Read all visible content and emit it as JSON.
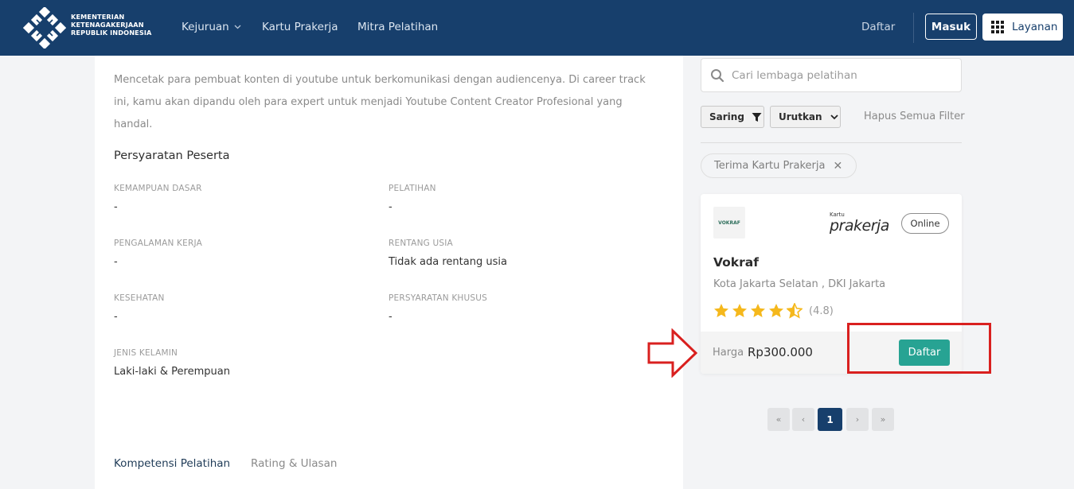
{
  "header": {
    "logo_lines": [
      "KEMENTERIAN",
      "KETENAGAKERJAAN",
      "REPUBLIK INDONESIA"
    ],
    "nav": [
      {
        "label": "Kejuruan",
        "has_dropdown": true,
        "icon": "chevron-down-icon"
      },
      {
        "label": "Kartu Prakerja"
      },
      {
        "label": "Mitra Pelatihan"
      }
    ],
    "daftar_label": "Daftar",
    "masuk_label": "Masuk",
    "layanan_label": "Layanan",
    "colors": {
      "bar": "#173f6c"
    }
  },
  "content": {
    "description": "Mencetak para pembuat konten di youtube untuk berkomunikasi dengan audiencenya. Di career track ini, kamu akan dipandu oleh para expert untuk menjadi Youtube Content Creator Profesional yang handal.",
    "requirements_title": "Persyaratan Peserta",
    "requirements": [
      {
        "label": "KEMAMPUAN DASAR",
        "value": "-"
      },
      {
        "label": "PELATIHAN",
        "value": "-"
      },
      {
        "label": "PENGALAMAN KERJA",
        "value": "-"
      },
      {
        "label": "RENTANG USIA",
        "value": "Tidak ada rentang usia"
      },
      {
        "label": "KESEHATAN",
        "value": "-"
      },
      {
        "label": "PERSYARATAN KHUSUS",
        "value": "-"
      },
      {
        "label": "JENIS KELAMIN",
        "value": "Laki-laki & Perempuan"
      }
    ],
    "tabs": [
      {
        "label": "Kompetensi Pelatihan",
        "active": true
      },
      {
        "label": "Rating & Ulasan",
        "active": false
      }
    ]
  },
  "sidebar": {
    "search_placeholder": "Cari lembaga pelatihan",
    "filter_label": "Saring",
    "sort_label": "Urutkan",
    "clear_filters_label": "Hapus Semua Filter",
    "active_filter": "Terima Kartu Prakerja",
    "card": {
      "provider_logo_text": "VOKRAF",
      "partner_logo_small": "Kartu",
      "partner_logo_big": "prakerja",
      "mode": "Online",
      "name": "Vokraf",
      "location": "Kota Jakarta Selatan , DKI Jakarta",
      "rating": 4.8,
      "rating_text": "(4.8)",
      "price_label": "Harga",
      "price": "Rp300.000",
      "daftar_label": "Daftar",
      "colors": {
        "button": "#27a393",
        "star": "#f5b81c"
      }
    },
    "pagination": [
      "«",
      "‹",
      "1",
      "›",
      "»"
    ],
    "current_page": "1"
  },
  "annotation": {
    "highlight_color": "#d9201f"
  }
}
